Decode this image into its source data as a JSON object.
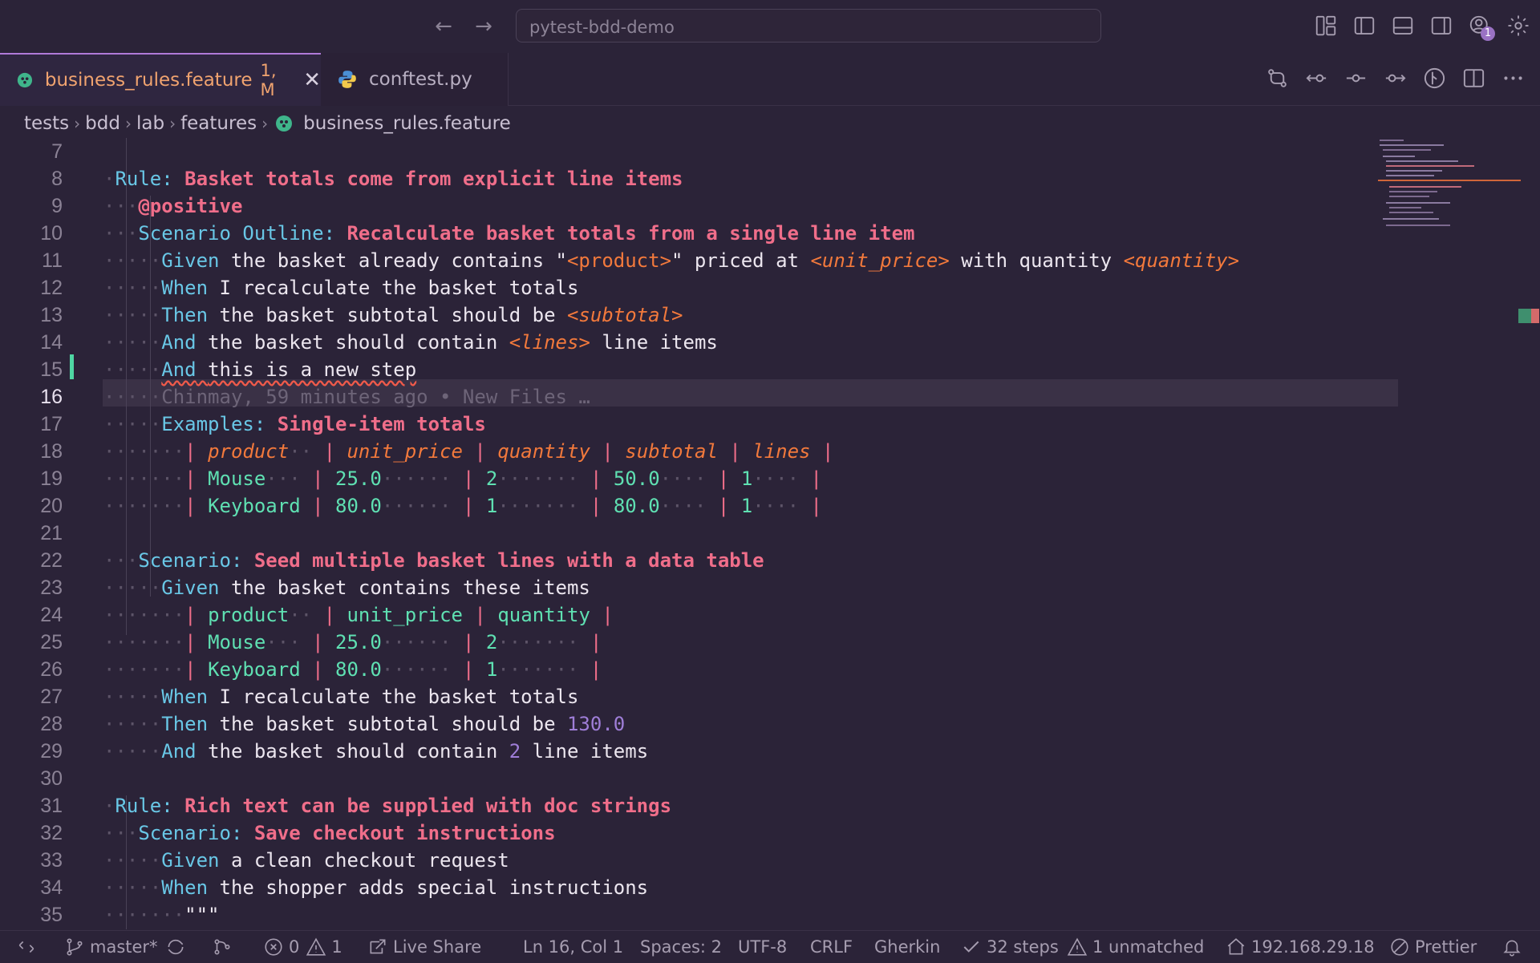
{
  "titlebar": {
    "search_text": "pytest-bdd-demo",
    "icons": [
      "arrow-left-icon",
      "arrow-right-icon",
      "layout-customize-icon",
      "toggle-primary-sidebar-icon",
      "toggle-panel-icon",
      "toggle-secondary-sidebar-icon",
      "accounts-icon",
      "settings-gear-icon"
    ],
    "accounts_badge": "1"
  },
  "tabs": [
    {
      "label": "business_rules.feature",
      "badge": "1, M",
      "active": true,
      "icon": "gherkin-icon"
    },
    {
      "label": "conftest.py",
      "active": false,
      "icon": "python-icon"
    }
  ],
  "breadcrumb": {
    "parts": [
      "tests",
      "bdd",
      "lab",
      "features"
    ],
    "file": "business_rules.feature"
  },
  "editor": {
    "line_numbers": [
      "7",
      "8",
      "9",
      "10",
      "11",
      "12",
      "13",
      "14",
      "15",
      "16",
      "17",
      "18",
      "19",
      "20",
      "21",
      "22",
      "23",
      "24",
      "25",
      "26",
      "27",
      "28",
      "29",
      "30",
      "31",
      "32",
      "33",
      "34",
      "35"
    ],
    "current_line": "16",
    "blame": "Chinmay, 59 minutes ago • New Files …",
    "lines": {
      "l8": {
        "kw": "Rule:",
        "title": "Basket totals come from explicit line items"
      },
      "l9": {
        "tag": "@positive"
      },
      "l10": {
        "kw": "Scenario Outline:",
        "title": "Recalculate basket totals from a single line item"
      },
      "l11": {
        "kw": "Given",
        "t1": "the basket already contains ",
        "q1": "\"",
        "p1": "<product>",
        "q2": "\"",
        "t2": " priced at ",
        "p2": "<unit_price>",
        "t3": " with quantity ",
        "p3": "<quantity>"
      },
      "l12": {
        "kw": "When",
        "t1": "I recalculate the basket totals"
      },
      "l13": {
        "kw": "Then",
        "t1": "the basket subtotal should be ",
        "p1": "<subtotal>"
      },
      "l14": {
        "kw": "And",
        "t1": "the basket should contain ",
        "p1": "<lines>",
        "t2": " line items"
      },
      "l15": {
        "kw": "And",
        "t1": "this is a new step"
      },
      "l17": {
        "kw": "Examples:",
        "title": "Single-item totals"
      },
      "l18": {
        "c": [
          "product",
          "unit_price",
          "quantity",
          "subtotal",
          "lines"
        ]
      },
      "l19": {
        "c": [
          "Mouse",
          "25.0",
          "2",
          "50.0",
          "1"
        ]
      },
      "l20": {
        "c": [
          "Keyboard",
          "80.0",
          "1",
          "80.0",
          "1"
        ]
      },
      "l22": {
        "kw": "Scenario:",
        "title": "Seed multiple basket lines with a data table"
      },
      "l23": {
        "kw": "Given",
        "t1": "the basket contains these items"
      },
      "l24": {
        "c": [
          "product",
          "unit_price",
          "quantity"
        ]
      },
      "l25": {
        "c": [
          "Mouse",
          "25.0",
          "2"
        ]
      },
      "l26": {
        "c": [
          "Keyboard",
          "80.0",
          "1"
        ]
      },
      "l27": {
        "kw": "When",
        "t1": "I recalculate the basket totals"
      },
      "l28": {
        "kw": "Then",
        "t1": "the basket subtotal should be ",
        "n1": "130.0"
      },
      "l29": {
        "kw": "And",
        "t1": "the basket should contain ",
        "n1": "2",
        "t2": " line items"
      },
      "l31": {
        "kw": "Rule:",
        "title": "Rich text can be supplied with doc strings"
      },
      "l32": {
        "kw": "Scenario:",
        "title": "Save checkout instructions"
      },
      "l33": {
        "kw": "Given",
        "t1": "a clean checkout request"
      },
      "l34": {
        "kw": "When",
        "t1": "the shopper adds special instructions"
      },
      "l35": {
        "t1": "\"\"\""
      }
    }
  },
  "statusbar": {
    "branch": "master*",
    "errors": "0",
    "warnings": "1",
    "live_share": "Live Share",
    "position": "Ln 16, Col 1",
    "spaces": "Spaces: 2",
    "encoding": "UTF-8",
    "eol": "CRLF",
    "language": "Gherkin",
    "steps": "32 steps",
    "unmatched": "1 unmatched",
    "ip": "192.168.29.18",
    "formatter": "Prettier"
  },
  "colors": {
    "background": "#2b2338",
    "keyword": "#69c7e6",
    "title": "#f06e8a",
    "placeholder": "#f2793c",
    "table_cell": "#5fe0b2",
    "number": "#9f7ed8",
    "tab_active_text": "#f0a36f"
  }
}
